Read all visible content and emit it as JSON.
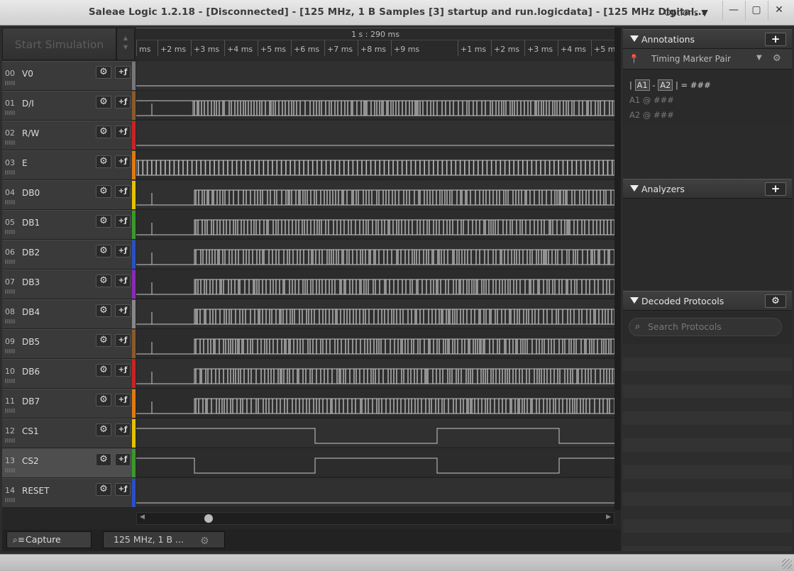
{
  "window": {
    "title": "Saleae Logic 1.2.18 - [Disconnected] - [125 MHz, 1 B Samples [3] startup and run.logicdata] - [125 MHz Digital...",
    "options_label": "Options ▼",
    "minimize": "—",
    "maximize": "▢",
    "close": "✕"
  },
  "toolbar": {
    "start_simulation": "Start Simulation"
  },
  "ruler": {
    "header": "1 s : 290 ms",
    "ticks": [
      "ms",
      "+2 ms",
      "+3 ms",
      "+4 ms",
      "+5 ms",
      "+6 ms",
      "+7 ms",
      "+8 ms",
      "+9 ms",
      "+1 ms",
      "+2 ms",
      "+3 ms",
      "+4 ms",
      "+5 m"
    ]
  },
  "channels": [
    {
      "num": "00",
      "name": "V0",
      "color": "#777777"
    },
    {
      "num": "01",
      "name": "D/I",
      "color": "#8b5a2b"
    },
    {
      "num": "02",
      "name": "R/W",
      "color": "#cc2222"
    },
    {
      "num": "03",
      "name": "E",
      "color": "#e07b10"
    },
    {
      "num": "04",
      "name": "DB0",
      "color": "#e6c200"
    },
    {
      "num": "05",
      "name": "DB1",
      "color": "#3a9a2a"
    },
    {
      "num": "06",
      "name": "DB2",
      "color": "#2a4fc8"
    },
    {
      "num": "07",
      "name": "DB3",
      "color": "#8a2ab8"
    },
    {
      "num": "08",
      "name": "DB4",
      "color": "#888888"
    },
    {
      "num": "09",
      "name": "DB5",
      "color": "#8b5a2b"
    },
    {
      "num": "10",
      "name": "DB6",
      "color": "#cc2222"
    },
    {
      "num": "11",
      "name": "DB7",
      "color": "#e07b10"
    },
    {
      "num": "12",
      "name": "CS1",
      "color": "#e6c200"
    },
    {
      "num": "13",
      "name": "CS2",
      "color": "#3a9a2a"
    },
    {
      "num": "14",
      "name": "RESET",
      "color": "#2a4fc8"
    }
  ],
  "channel_buttons": {
    "gear": "⚙",
    "trigger": "+ƒ"
  },
  "bottom": {
    "capture_tab": "Capture",
    "session_tab": "125 MHz, 1 B ...",
    "gear": "⚙"
  },
  "annotations": {
    "title": "Annotations",
    "add": "+",
    "marker_type": "Timing Marker Pair",
    "formula_prefix": "|",
    "a1": "A1",
    "minus": "-",
    "a2": "A2",
    "formula_suffix": "| = ###",
    "a1_row": "A1  @  ###",
    "a2_row": "A2  @  ###"
  },
  "analyzers": {
    "title": "Analyzers",
    "add": "+"
  },
  "decoded": {
    "title": "Decoded Protocols",
    "gear": "⚙",
    "search_placeholder": "Search Protocols"
  }
}
